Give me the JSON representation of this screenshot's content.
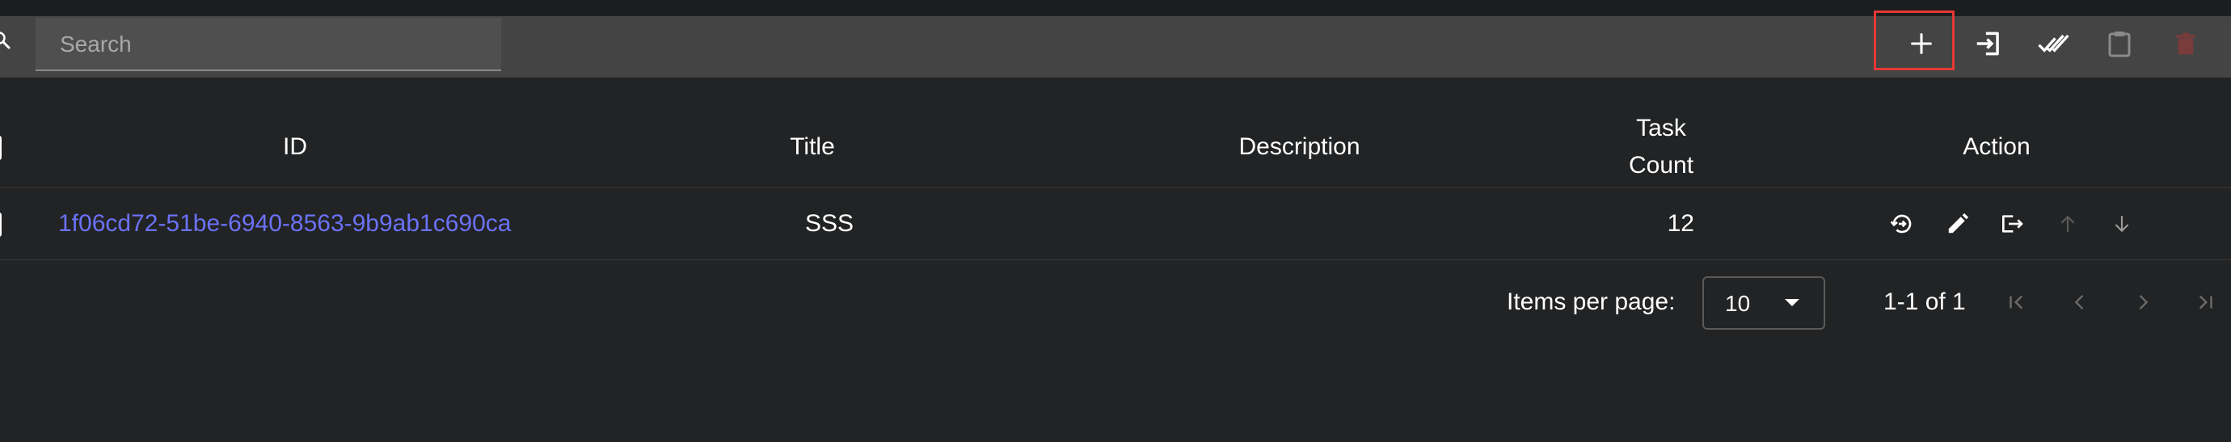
{
  "toolbar": {
    "search_placeholder": "Search",
    "search_value": "",
    "buttons": [
      {
        "name": "add",
        "icon": "plus-icon"
      },
      {
        "name": "import",
        "icon": "login-icon"
      },
      {
        "name": "mark-done",
        "icon": "done-all-icon"
      },
      {
        "name": "clipboard",
        "icon": "clipboard-icon"
      },
      {
        "name": "delete",
        "icon": "trash-icon"
      }
    ]
  },
  "table": {
    "columns": [
      "ID",
      "Title",
      "Description",
      "Task\nCount",
      "Action"
    ],
    "column_task_line1": "Task",
    "column_task_line2": "Count",
    "rows": [
      {
        "id": "1f06cd72-51be-6940-8563-9b9ab1c690ca",
        "title": "SSS",
        "description": "",
        "task_count": "12",
        "actions": [
          "history-icon",
          "edit-icon",
          "export-icon",
          "arrow-up-icon",
          "arrow-down-icon"
        ]
      }
    ]
  },
  "pagination": {
    "items_per_page_label": "Items per page:",
    "items_per_page_value": "10",
    "range_text": "1-1 of 1",
    "buttons": [
      "first-page-icon",
      "previous-page-icon",
      "next-page-icon",
      "last-page-icon"
    ]
  },
  "colors": {
    "background": "#222324",
    "toolbar": "#444444",
    "link": "#6b72f7",
    "highlight": "#e53935",
    "delete_disabled": "#7a3b3b"
  }
}
